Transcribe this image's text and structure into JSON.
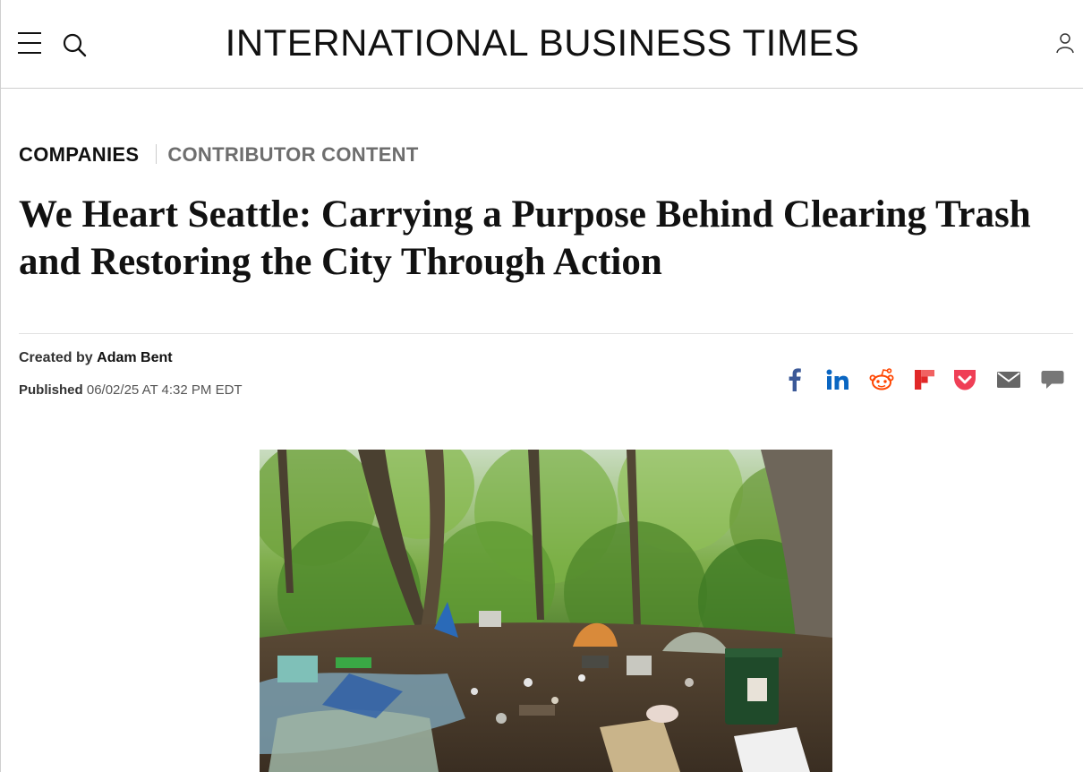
{
  "site": {
    "logo_text": "INTERNATIONAL BUSINESS TIMES"
  },
  "header": {
    "icons": [
      "menu-icon",
      "search-icon",
      "user-icon"
    ]
  },
  "article": {
    "category_primary": "COMPANIES",
    "category_secondary": "CONTRIBUTOR CONTENT",
    "headline": "We Heart Seattle: Carrying a Purpose Behind Clearing Trash and Restoring the City Through Action",
    "byline_label": "Created by",
    "author": "Adam Bent",
    "published_label": "Published",
    "published_date": "06/02/25 AT 4:32 PM EDT"
  },
  "share": {
    "icons": [
      "facebook-icon",
      "linkedin-icon",
      "reddit-icon",
      "flipboard-icon",
      "pocket-icon",
      "email-icon",
      "comment-icon"
    ],
    "colors": {
      "facebook": "#3b5998",
      "linkedin": "#0a66c2",
      "reddit": "#ff4500",
      "flipboard": "#e12828",
      "pocket": "#ef3f56",
      "email": "#666666",
      "comment": "#777777"
    }
  },
  "hero_image": {
    "subject": "forest-campsite-with-trash-photo"
  }
}
